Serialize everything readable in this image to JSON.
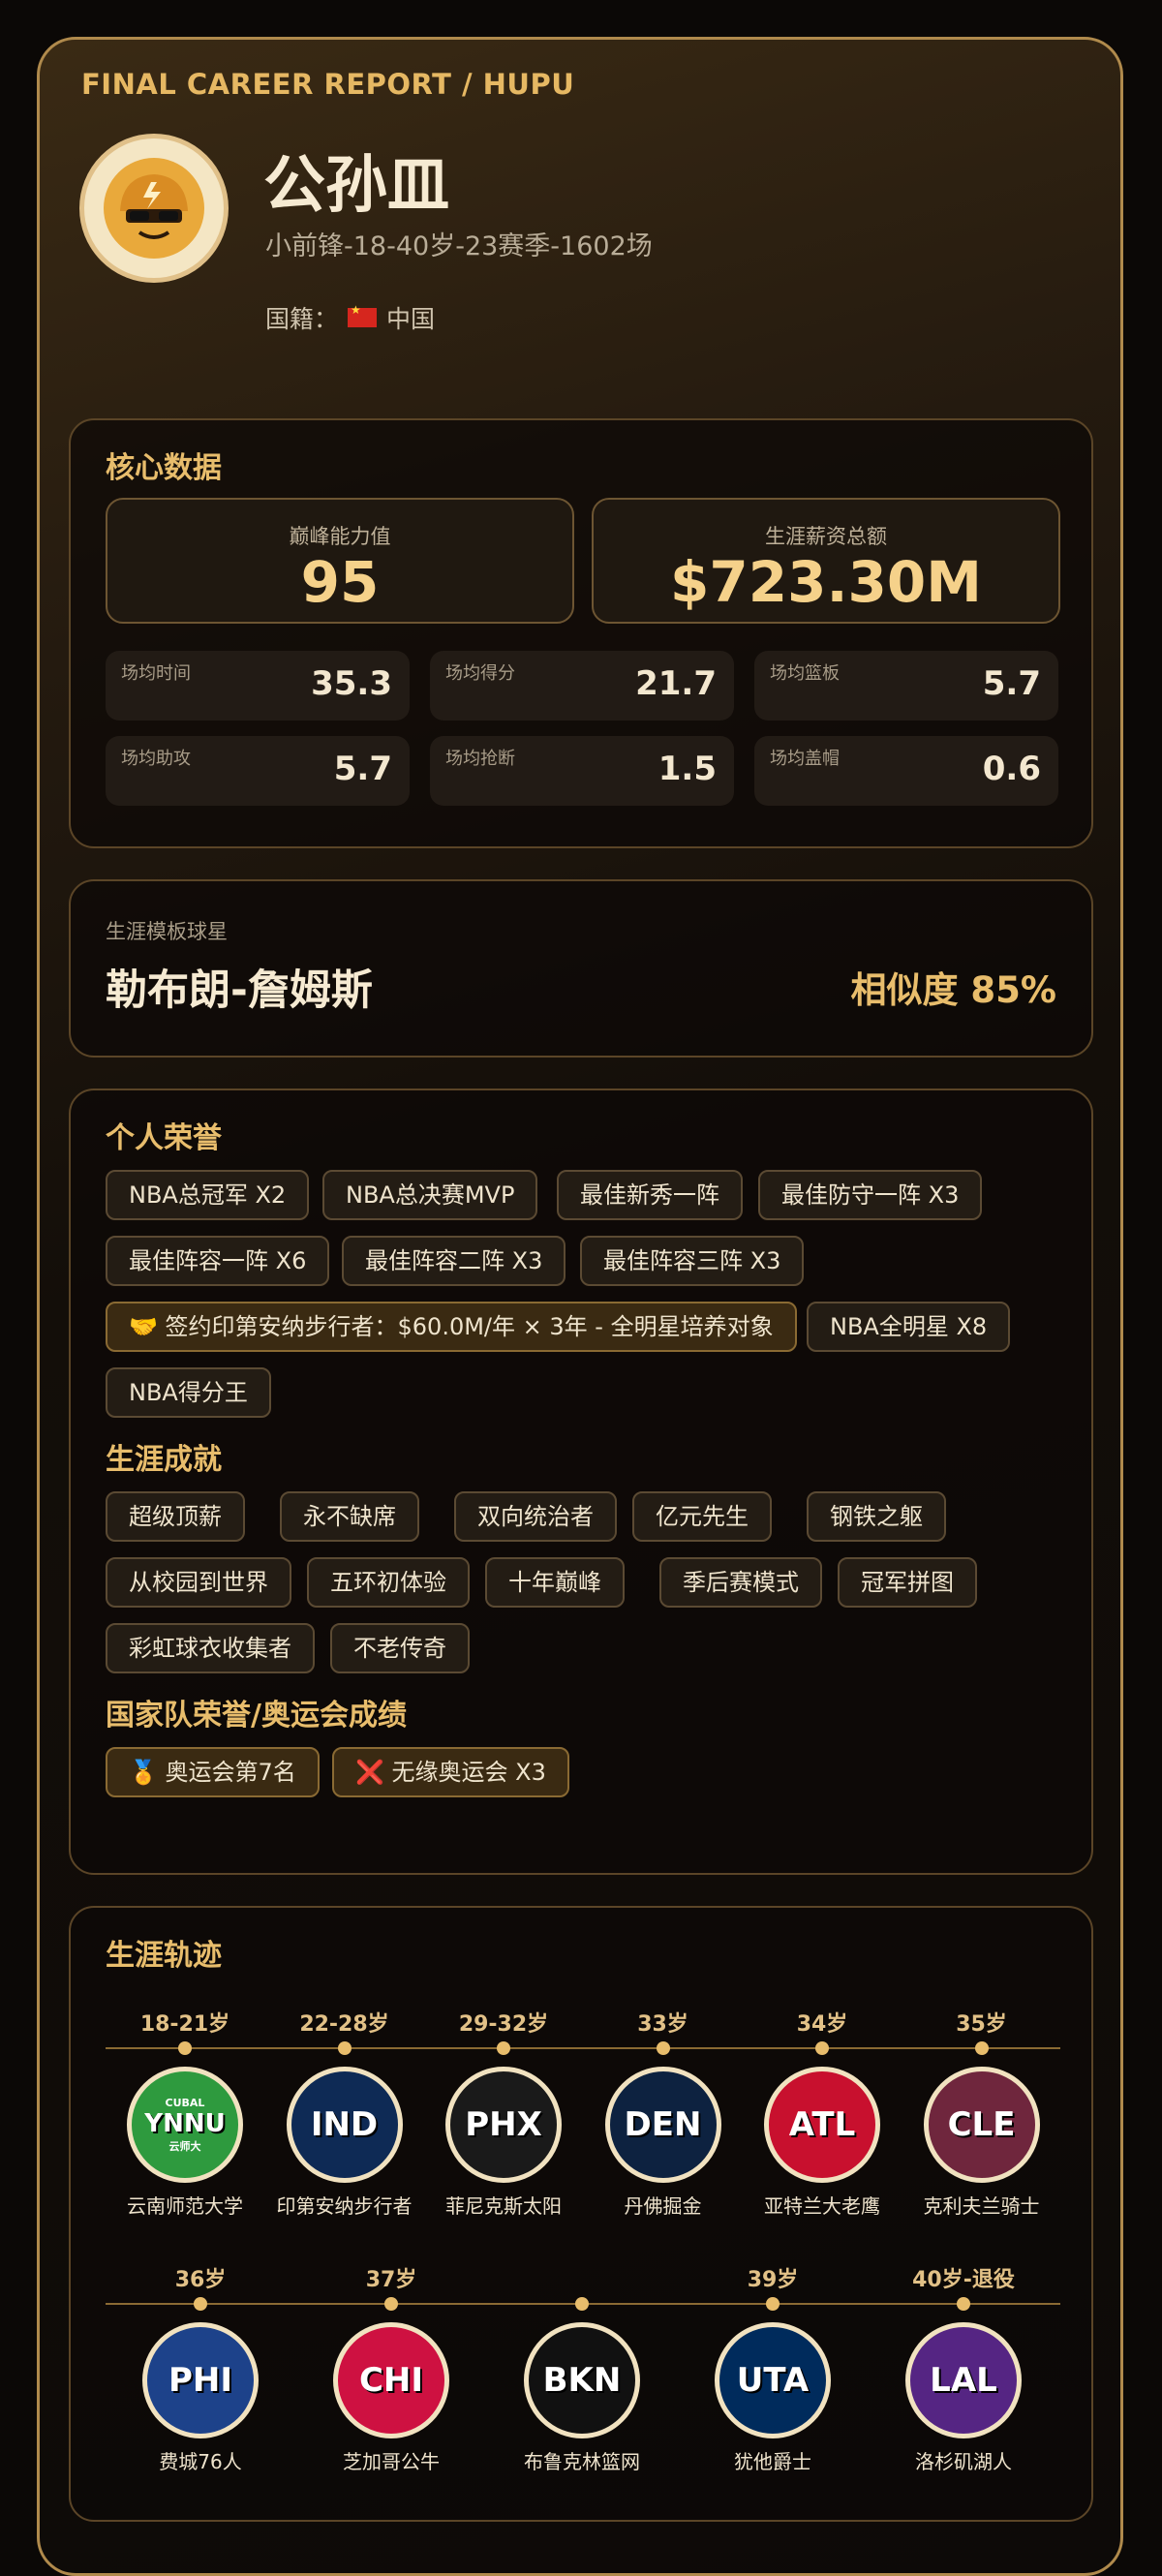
{
  "header": {
    "brand": "FINAL CAREER REPORT / HUPU",
    "player_name": "公孙皿",
    "subtitle": "小前锋-18-40岁-23赛季-1602场",
    "nationality_label": "国籍：",
    "nationality": "中国"
  },
  "core": {
    "title": "核心数据",
    "peak_label": "巅峰能力值",
    "peak_value": "95",
    "salary_label": "生涯薪资总额",
    "salary_value": "$723.30M",
    "stats": [
      {
        "label": "场均时间",
        "value": "35.3"
      },
      {
        "label": "场均得分",
        "value": "21.7"
      },
      {
        "label": "场均篮板",
        "value": "5.7"
      },
      {
        "label": "场均助攻",
        "value": "5.7"
      },
      {
        "label": "场均抢断",
        "value": "1.5"
      },
      {
        "label": "场均盖帽",
        "value": "0.6"
      }
    ]
  },
  "template": {
    "label": "生涯模板球星",
    "name": "勒布朗-詹姆斯",
    "similarity": "相似度 85%"
  },
  "honors": {
    "title": "个人荣誉",
    "items": [
      "NBA总冠军 X2",
      "NBA总决赛MVP",
      "最佳新秀一阵",
      "最佳防守一阵 X3",
      "最佳阵容一阵 X6",
      "最佳阵容二阵 X3",
      "最佳阵容三阵 X3",
      "🤝 签约印第安纳步行者：$60.0M/年 × 3年 - 全明星培养对象",
      "NBA全明星 X8",
      "NBA得分王"
    ]
  },
  "achievements": {
    "title": "生涯成就",
    "items": [
      "超级顶薪",
      "永不缺席",
      "双向统治者",
      "亿元先生",
      "钢铁之躯",
      "从校园到世界",
      "五环初体验",
      "十年巅峰",
      "季后赛模式",
      "冠军拼图",
      "彩虹球衣收集者",
      "不老传奇"
    ]
  },
  "national": {
    "title": "国家队荣誉/奥运会成绩",
    "items": [
      "🏅 奥运会第7名",
      "❌ 无缘奥运会 X3"
    ]
  },
  "timeline": {
    "title": "生涯轨迹",
    "row1": [
      {
        "age": "18-21岁",
        "abbr": "YNNU",
        "top": "CUBAL",
        "bottom": "云师大",
        "team": "云南师范大学",
        "color": "#2e9a3e"
      },
      {
        "age": "22-28岁",
        "abbr": "IND",
        "team": "印第安纳步行者",
        "color": "#0e2a55"
      },
      {
        "age": "29-32岁",
        "abbr": "PHX",
        "team": "菲尼克斯太阳",
        "color": "#1a1a1a"
      },
      {
        "age": "33岁",
        "abbr": "DEN",
        "team": "丹佛掘金",
        "color": "#0d2240"
      },
      {
        "age": "34岁",
        "abbr": "ATL",
        "team": "亚特兰大老鹰",
        "color": "#c8102e"
      },
      {
        "age": "35岁",
        "abbr": "CLE",
        "team": "克利夫兰骑士",
        "color": "#6f263d"
      }
    ],
    "row2": [
      {
        "age": "36岁",
        "abbr": "PHI",
        "team": "费城76人",
        "color": "#1d428a"
      },
      {
        "age": "37岁",
        "abbr": "CHI",
        "team": "芝加哥公牛",
        "color": "#ce1141"
      },
      {
        "age": "",
        "abbr": "BKN",
        "team": "布鲁克林篮网",
        "color": "#111111"
      },
      {
        "age": "39岁",
        "abbr": "UTA",
        "team": "犹他爵士",
        "color": "#002b5c"
      },
      {
        "age": "40岁-退役",
        "abbr": "LAL",
        "team": "洛杉矶湖人",
        "color": "#552583"
      }
    ]
  }
}
